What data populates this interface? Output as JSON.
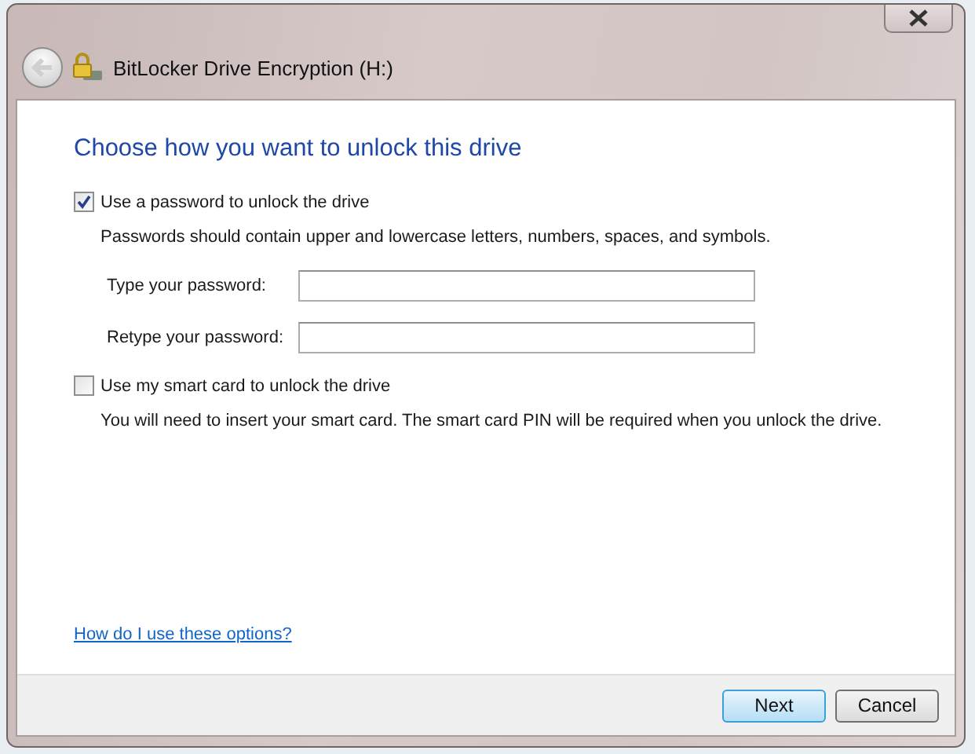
{
  "window": {
    "title": "BitLocker Drive Encryption (H:)"
  },
  "heading": "Choose how you want to unlock this drive",
  "options": [
    {
      "kind": "password",
      "label": "Use a password to unlock the drive",
      "checked": true,
      "description": "Passwords should contain upper and lowercase letters, numbers, spaces, and symbols.",
      "fields": [
        {
          "label": "Type your password:"
        },
        {
          "label": "Retype your password:"
        }
      ]
    },
    {
      "kind": "smartcard",
      "label": "Use my smart card to unlock the drive",
      "checked": false,
      "description": "You will need to insert your smart card. The smart card PIN will be required when you unlock the drive."
    }
  ],
  "help_link": "How do I use these options?",
  "buttons": [
    {
      "label": "Next",
      "default": true
    },
    {
      "label": "Cancel",
      "default": false
    }
  ]
}
